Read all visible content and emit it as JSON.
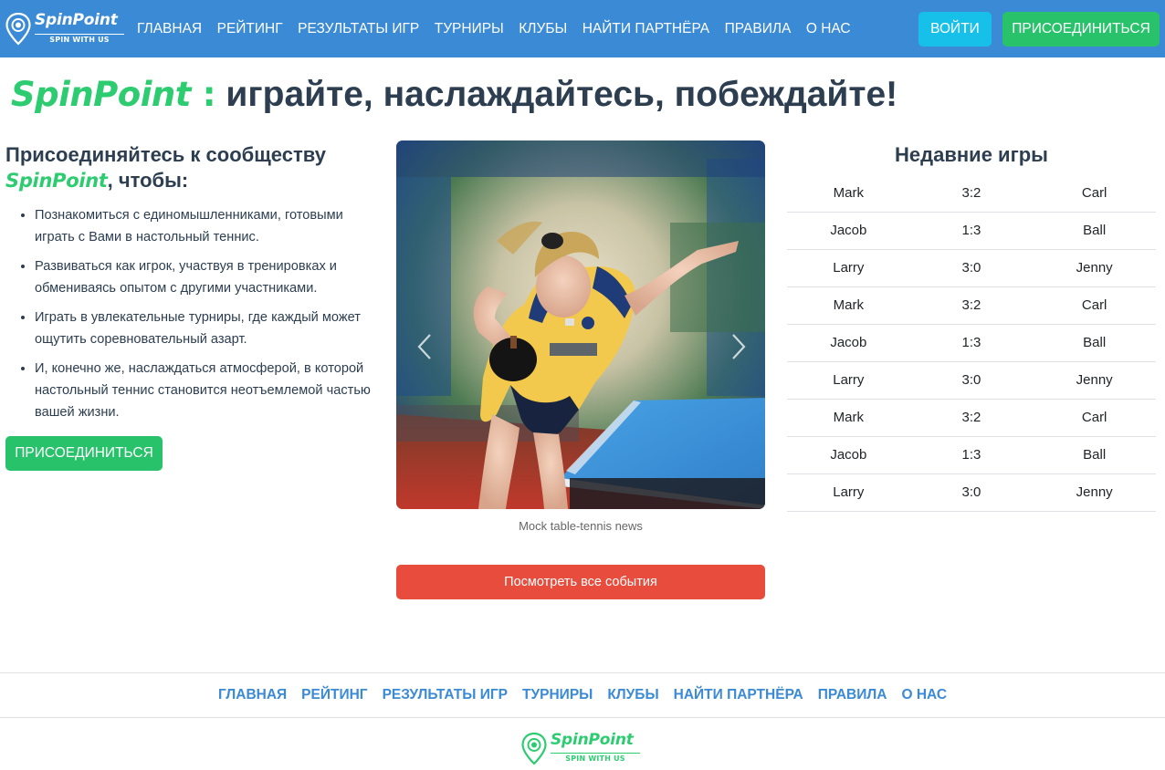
{
  "brand": {
    "name": "SpinPoint",
    "slogan": "SPIN WITH US"
  },
  "nav": {
    "items": [
      "ГЛАВНАЯ",
      "РЕЙТИНГ",
      "РЕЗУЛЬТАТЫ ИГР",
      "ТУРНИРЫ",
      "КЛУБЫ",
      "НАЙТИ ПАРТНЁРА",
      "ПРАВИЛА",
      "О НАС"
    ],
    "login": "ВОЙТИ",
    "join": "ПРИСОЕДИНИТЬСЯ"
  },
  "hero": {
    "brand": "SpinPoint",
    "colon": " :",
    "tagline": " играйте, наслаждайтесь, побеждайте!"
  },
  "community": {
    "title_start": "Присоединяйтесь к сообществу ",
    "title_brand": "SpinPoint",
    "title_end": ", чтобы:",
    "benefits": [
      "Познакомиться с единомышленниками, готовыми играть с Вами в настольный теннис.",
      "Развиваться как игрок, участвуя в тренировках и обмениваясь опытом с другими участниками.",
      "Играть в увлекательные турниры, где каждый может ощутить соревновательный азарт.",
      "И, конечно же, наслаждаться атмосферой, в которой настольный теннис становится неотъемлемой частью вашей жизни."
    ],
    "join_button": "ПРИСОЕДИНИТЬСЯ"
  },
  "news": {
    "caption": "Mock table-tennis news",
    "events_button": "Посмотреть все события"
  },
  "games": {
    "title": "Недавние игры",
    "rows": [
      {
        "player1": "Mark",
        "score": "3:2",
        "player2": "Carl"
      },
      {
        "player1": "Jacob",
        "score": "1:3",
        "player2": "Ball"
      },
      {
        "player1": "Larry",
        "score": "3:0",
        "player2": "Jenny"
      },
      {
        "player1": "Mark",
        "score": "3:2",
        "player2": "Carl"
      },
      {
        "player1": "Jacob",
        "score": "1:3",
        "player2": "Ball"
      },
      {
        "player1": "Larry",
        "score": "3:0",
        "player2": "Jenny"
      },
      {
        "player1": "Mark",
        "score": "3:2",
        "player2": "Carl"
      },
      {
        "player1": "Jacob",
        "score": "1:3",
        "player2": "Ball"
      },
      {
        "player1": "Larry",
        "score": "3:0",
        "player2": "Jenny"
      }
    ]
  },
  "footer": {
    "nav": [
      "ГЛАВНАЯ",
      "РЕЙТИНГ",
      "РЕЗУЛЬТАТЫ ИГР",
      "ТУРНИРЫ",
      "КЛУБЫ",
      "НАЙТИ ПАРТНЁРА",
      "ПРАВИЛА",
      "О НАС"
    ]
  },
  "colors": {
    "navbar": "#3a8ad6",
    "login_button": "#17c0e8",
    "join_button": "#27c26a",
    "brand_green": "#2ecc71",
    "events_button": "#e74c3c",
    "footer_link": "#3a8ad6"
  },
  "icons": {
    "logo": "location-pin-icon",
    "carousel_prev": "chevron-left-icon",
    "carousel_next": "chevron-right-icon"
  }
}
